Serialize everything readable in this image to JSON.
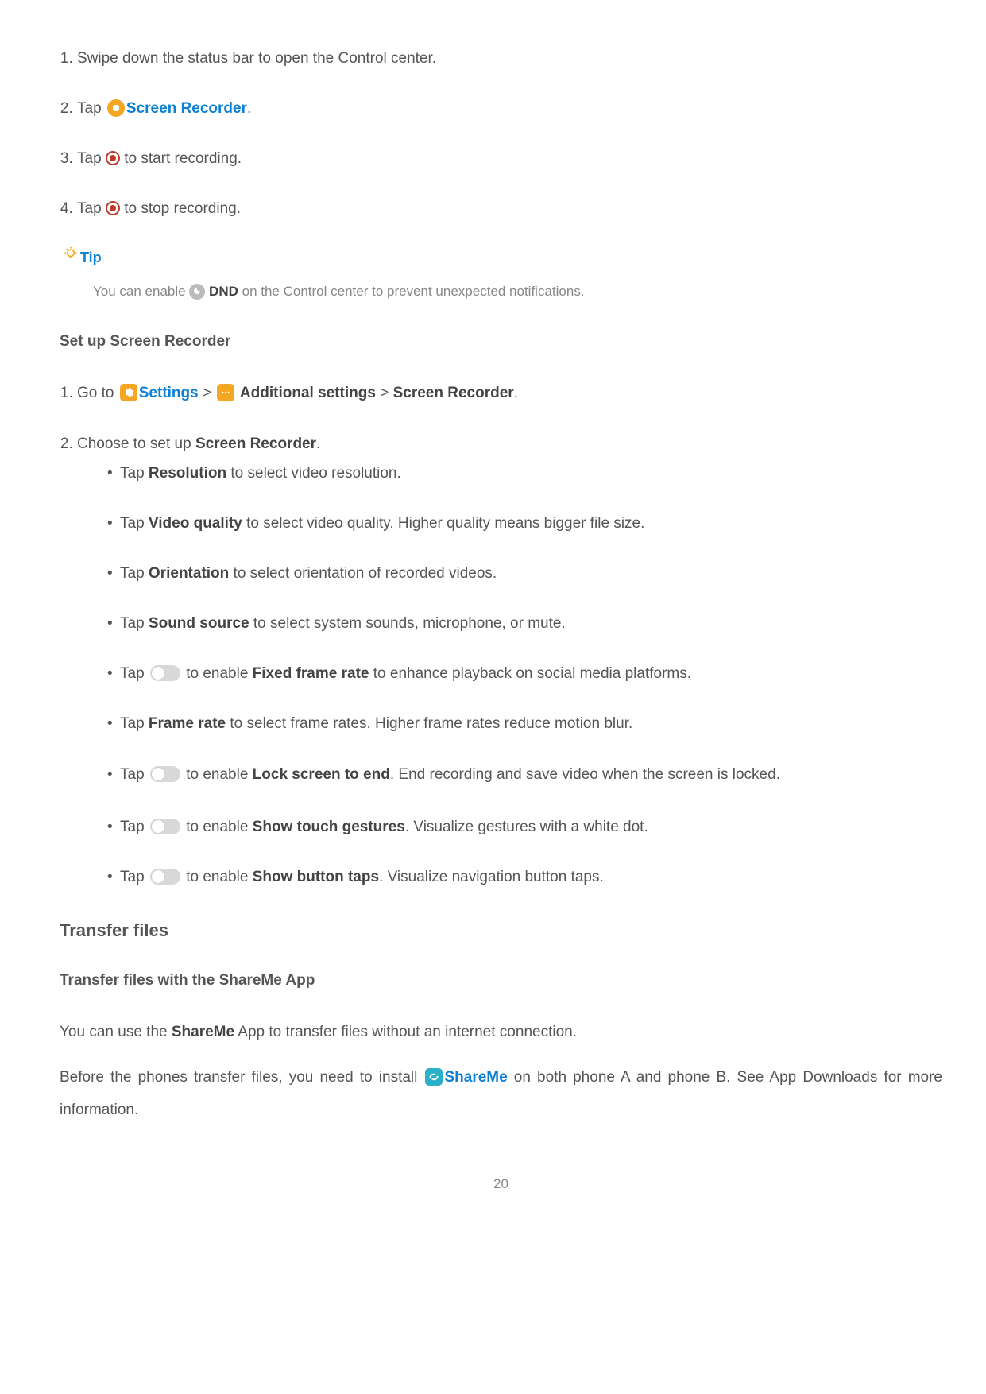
{
  "steps": {
    "s1": "Swipe down the status bar to open the Control center.",
    "s2a": "Tap ",
    "s2b": "Screen Recorder",
    "s2c": ".",
    "s3a": "Tap ",
    "s3b": " to start recording.",
    "s4a": "Tap ",
    "s4b": " to stop recording."
  },
  "tip": {
    "label": "Tip",
    "body_a": "You can enable ",
    "dnd": " DND",
    "body_b": " on the Control center to prevent unexpected notifications."
  },
  "setup": {
    "title": "Set up Screen Recorder",
    "s1a": "Go to ",
    "settings": "Settings",
    "gt1": " > ",
    "additional": " Additional settings",
    "gt2": " > ",
    "screenrec": "Screen Recorder",
    "dot": ".",
    "s2a": "Choose to set up ",
    "s2b": "Screen Recorder",
    "s2c": ".",
    "b1a": "Tap ",
    "b1b": "Resolution",
    "b1c": " to select video resolution.",
    "b2a": "Tap ",
    "b2b": "Video quality",
    "b2c": " to select video quality. Higher quality means bigger file size.",
    "b3a": "Tap ",
    "b3b": "Orientation",
    "b3c": " to select orientation of recorded videos.",
    "b4a": "Tap ",
    "b4b": "Sound source",
    "b4c": " to select system sounds, microphone, or mute.",
    "b5a": "Tap ",
    "b5b": " to enable ",
    "b5c": "Fixed frame rate",
    "b5d": " to enhance playback on social media platforms.",
    "b6a": "Tap ",
    "b6b": "Frame rate",
    "b6c": " to select frame rates. Higher frame rates reduce motion blur.",
    "b7a": "Tap ",
    "b7b": " to enable ",
    "b7c": "Lock screen to end",
    "b7d": ". End recording and save video when the screen is locked.",
    "b8a": "Tap ",
    "b8b": " to enable ",
    "b8c": "Show touch gestures",
    "b8d": ". Visualize gestures with a white dot.",
    "b9a": "Tap ",
    "b9b": " to enable ",
    "b9c": "Show button taps",
    "b9d": ". Visualize navigation button taps."
  },
  "transfer": {
    "title": "Transfer files",
    "subtitle": "Transfer files with the ShareMe App",
    "p1a": "You can use the ",
    "p1b": "ShareMe",
    "p1c": " App to transfer files without an internet connection.",
    "p2a": "Before the phones transfer files, you need to install ",
    "p2b": "ShareMe",
    "p2c": " on both phone A and phone B. See App Downloads for more information."
  },
  "pagenum": "20"
}
